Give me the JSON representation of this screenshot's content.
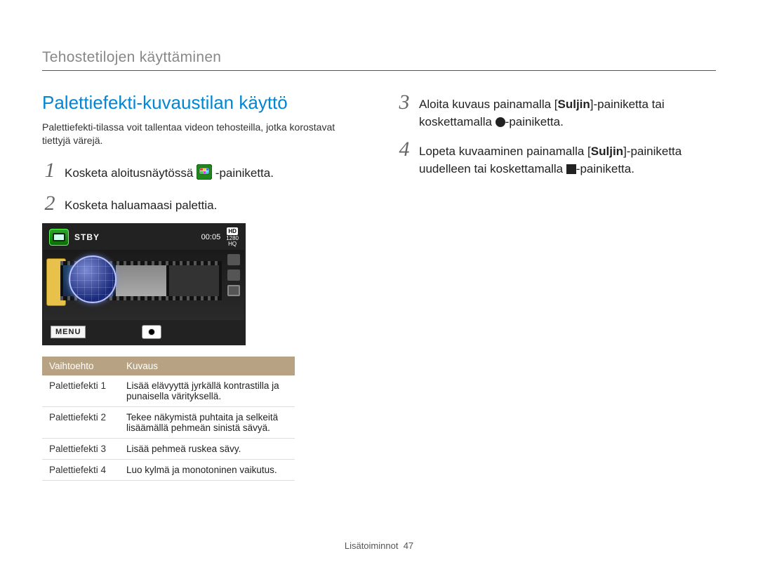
{
  "section_title": "Tehostetilojen käyttäminen",
  "heading": "Palettiefekti-kuvaustilan käyttö",
  "lead": "Palettiefekti-tilassa voit tallentaa videon tehosteilla, jotka korostavat tiettyjä värejä.",
  "steps_left": [
    {
      "num": "1",
      "before": "Kosketa aloitusnäytössä ",
      "after": "-painiketta."
    },
    {
      "num": "2",
      "text": "Kosketa haluamaasi palettia."
    }
  ],
  "steps_right": [
    {
      "num": "3",
      "before": "Aloita kuvaus painamalla [",
      "bold": "Suljin",
      "mid": "]-painiketta tai koskettamalla ",
      "after": "-painiketta."
    },
    {
      "num": "4",
      "before": "Lopeta kuvaaminen painamalla [",
      "bold": "Suljin",
      "mid": "]-painiketta uudelleen tai koskettamalla ",
      "after": "-painiketta."
    }
  ],
  "camera": {
    "stby": "STBY",
    "timer": "00:05",
    "hd": "HD",
    "res_top": "1280",
    "res_bottom": "HQ",
    "menu": "MENU"
  },
  "table": {
    "h1": "Vaihtoehto",
    "h2": "Kuvaus",
    "rows": [
      {
        "opt": "Palettiefekti 1",
        "desc": "Lisää elävyyttä jyrkällä kontrastilla ja punaisella värityksellä."
      },
      {
        "opt": "Palettiefekti 2",
        "desc": "Tekee näkymistä puhtaita ja selkeitä lisäämällä pehmeän sinistä sävyä."
      },
      {
        "opt": "Palettiefekti 3",
        "desc": "Lisää pehmeä ruskea sävy."
      },
      {
        "opt": "Palettiefekti 4",
        "desc": "Luo kylmä ja monotoninen vaikutus."
      }
    ]
  },
  "footer": {
    "label": "Lisätoiminnot",
    "page": "47"
  }
}
